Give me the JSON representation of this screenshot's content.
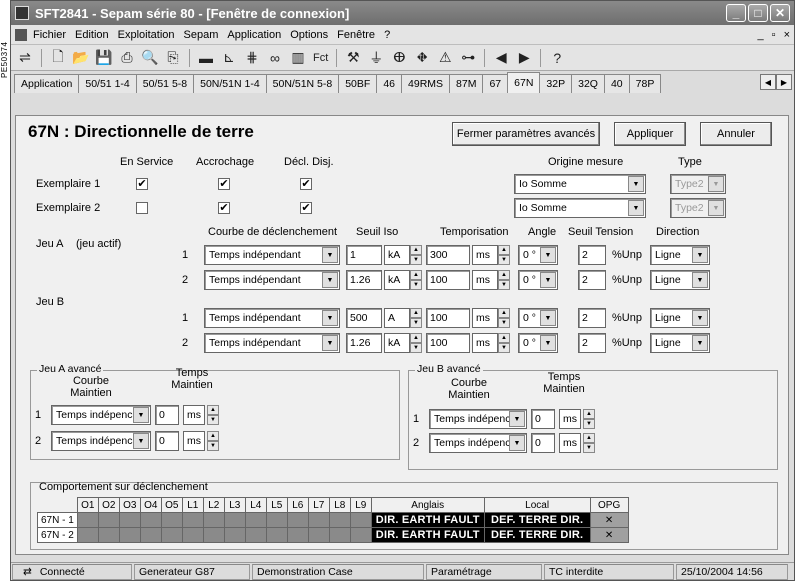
{
  "side_label": "PE50374",
  "window": {
    "title": "SFT2841 - Sepam série 80 - [Fenêtre de connexion]",
    "buttons": [
      "_",
      "□",
      "✕"
    ]
  },
  "menubar": {
    "items": [
      "Fichier",
      "Edition",
      "Exploitation",
      "Sepam",
      "Application",
      "Options",
      "Fenêtre",
      "?"
    ],
    "mdi_controls": [
      "_",
      "▫",
      "×"
    ]
  },
  "toolbar": {
    "fct_label": "Fct"
  },
  "tabs": [
    "Application",
    "50/51 1-4",
    "50/51 5-8",
    "50N/51N 1-4",
    "50N/51N 5-8",
    "50BF",
    "46",
    "49RMS",
    "87M",
    "67",
    "67N",
    "32P",
    "32Q",
    "40",
    "78P"
  ],
  "active_tab": "67N",
  "page": {
    "title": "67N : Directionnelle de terre",
    "close_advanced_label": "Fermer paramètres avancés",
    "apply_label": "Appliquer",
    "cancel_label": "Annuler"
  },
  "instances": {
    "headers": {
      "in_service": "En Service",
      "latching": "Accrochage",
      "trip_cb": "Décl. Disj.",
      "origin": "Origine mesure",
      "type": "Type"
    },
    "rows": [
      {
        "label": "Exemplaire 1",
        "in_service": "✔",
        "latching": "✔",
        "trip_cb": "✔",
        "origin": "Io Somme",
        "type": "Type2"
      },
      {
        "label": "Exemplaire 2",
        "in_service": "",
        "latching": "✔",
        "trip_cb": "✔",
        "origin": "Io Somme",
        "type": "Type2"
      }
    ]
  },
  "settings": {
    "headers": {
      "curve": "Courbe de déclenchement",
      "threshold": "Seuil Iso",
      "delay": "Temporisation",
      "angle": "Angle",
      "voltage": "Seuil Tension",
      "direction": "Direction"
    },
    "jeu_a_label": "Jeu A",
    "jeu_a_active": "(jeu actif)",
    "jeu_b_label": "Jeu B",
    "rows": [
      {
        "num": "1",
        "curve": "Temps indépendant",
        "threshold": "1",
        "thr_unit": "kA",
        "delay": "300",
        "delay_unit": "ms",
        "angle": "0 °",
        "voltage": "2",
        "volt_unit": "%Unp",
        "direction": "Ligne"
      },
      {
        "num": "2",
        "curve": "Temps indépendant",
        "threshold": "1.26",
        "thr_unit": "kA",
        "delay": "100",
        "delay_unit": "ms",
        "angle": "0 °",
        "voltage": "2",
        "volt_unit": "%Unp",
        "direction": "Ligne"
      },
      {
        "num": "1",
        "curve": "Temps indépendant",
        "threshold": "500",
        "thr_unit": "A",
        "delay": "100",
        "delay_unit": "ms",
        "angle": "0 °",
        "voltage": "2",
        "volt_unit": "%Unp",
        "direction": "Ligne"
      },
      {
        "num": "2",
        "curve": "Temps indépendant",
        "threshold": "1.26",
        "thr_unit": "kA",
        "delay": "100",
        "delay_unit": "ms",
        "angle": "0 °",
        "voltage": "2",
        "volt_unit": "%Unp",
        "direction": "Ligne"
      }
    ]
  },
  "advanced": {
    "a_title": "Jeu A avancé",
    "b_title": "Jeu B avancé",
    "curve_header_1": "Courbe",
    "curve_header_2": "Maintien",
    "time_header_1": "Temps",
    "time_header_2": "Maintien",
    "a_rows": [
      {
        "num": "1",
        "curve": "Temps indépenc",
        "time": "0",
        "unit": "ms"
      },
      {
        "num": "2",
        "curve": "Temps indépenc",
        "time": "0",
        "unit": "ms"
      }
    ],
    "b_rows": [
      {
        "num": "1",
        "curve": "Temps indépenc",
        "time": "0",
        "unit": "ms"
      },
      {
        "num": "2",
        "curve": "Temps indépenc",
        "time": "0",
        "unit": "ms"
      }
    ]
  },
  "behavior": {
    "title": "Comportement sur déclenchement",
    "columns": [
      "O1",
      "O2",
      "O3",
      "O4",
      "O5",
      "L1",
      "L2",
      "L3",
      "L4",
      "L5",
      "L6",
      "L7",
      "L8",
      "L9"
    ],
    "english_header": "Anglais",
    "local_header": "Local",
    "opg_header": "OPG",
    "rows": [
      {
        "label": "67N - 1",
        "english": "DIR. EARTH FAULT",
        "local": "DEF. TERRE DIR.",
        "opg": "✕"
      },
      {
        "label": "67N - 2",
        "english": "DIR. EARTH FAULT",
        "local": "DEF. TERRE DIR.",
        "opg": "✕"
      }
    ]
  },
  "status": {
    "connection": "Connecté",
    "generator": "Generateur G87",
    "case": "Demonstration Case",
    "mode": "Paramétrage",
    "tc": "TC interdite",
    "datetime": "25/10/2004 14:56"
  }
}
